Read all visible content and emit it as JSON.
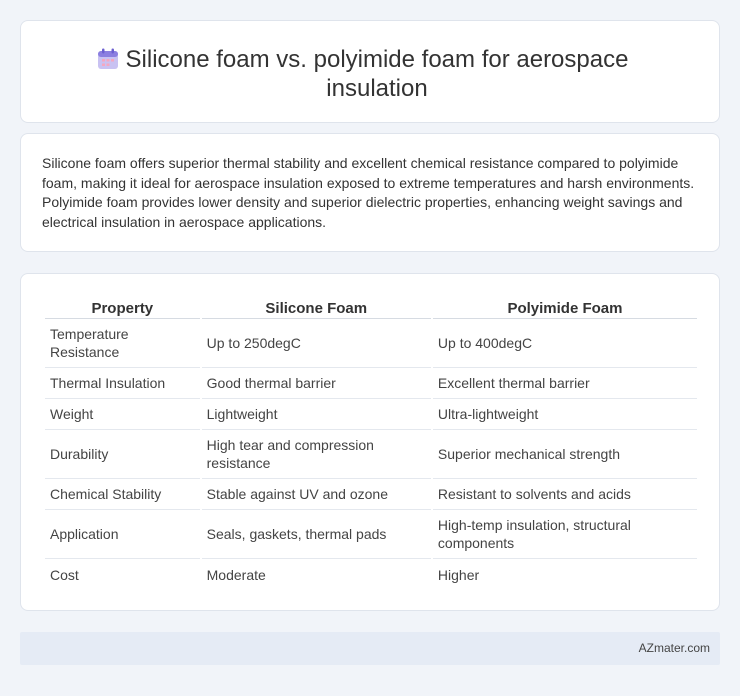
{
  "header": {
    "icon": "calendar-icon",
    "title": "Silicone foam vs. polyimide foam for aerospace insulation"
  },
  "summary": {
    "text": "Silicone foam offers superior thermal stability and excellent chemical resistance compared to polyimide foam, making it ideal for aerospace insulation exposed to extreme temperatures and harsh environments. Polyimide foam provides lower density and superior dielectric properties, enhancing weight savings and electrical insulation in aerospace applications."
  },
  "table": {
    "headers": [
      "Property",
      "Silicone Foam",
      "Polyimide Foam"
    ],
    "rows": [
      [
        "Temperature Resistance",
        "Up to 250degC",
        "Up to 400degC"
      ],
      [
        "Thermal Insulation",
        "Good thermal barrier",
        "Excellent thermal barrier"
      ],
      [
        "Weight",
        "Lightweight",
        "Ultra-lightweight"
      ],
      [
        "Durability",
        "High tear and compression resistance",
        "Superior mechanical strength"
      ],
      [
        "Chemical Stability",
        "Stable against UV and ozone",
        "Resistant to solvents and acids"
      ],
      [
        "Application",
        "Seals, gaskets, thermal pads",
        "High-temp insulation, structural components"
      ],
      [
        "Cost",
        "Moderate",
        "Higher"
      ]
    ]
  },
  "footer": {
    "site": "AZmater.com"
  },
  "colors": {
    "background": "#f1f4f9",
    "card": "#ffffff",
    "footer": "#e5ebf5",
    "icon_accent": "#8b7fe0"
  }
}
